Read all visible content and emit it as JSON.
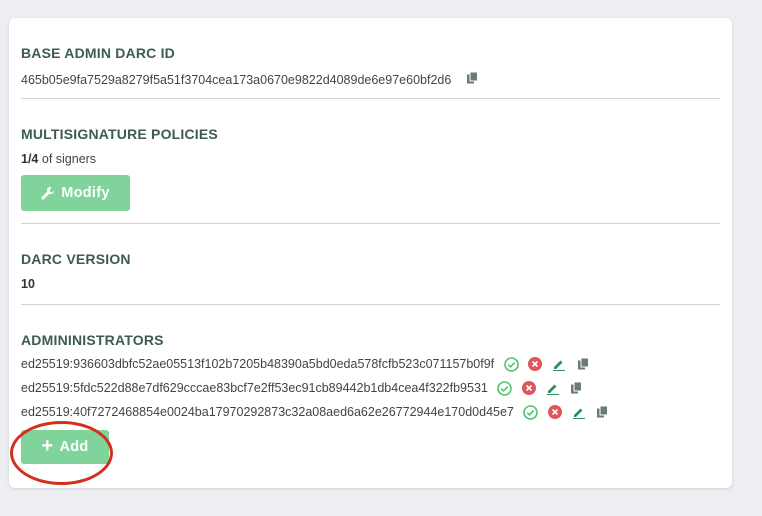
{
  "base_admin": {
    "heading": "BASE ADMIN DARC ID",
    "value": "465b05e9fa7529a8279f5a51f3704cea173a0670e9822d4089de6e97e60bf2d6"
  },
  "multisig": {
    "heading": "MULTISIGNATURE POLICIES",
    "ratio": "1/4",
    "suffix": " of signers",
    "modify_label": "Modify"
  },
  "darc_version": {
    "heading": "DARC VERSION",
    "value": "10"
  },
  "administrators": {
    "heading": "ADMININISTRATORS",
    "items": [
      "ed25519:936603dbfc52ae05513f102b7205b48390a5bd0eda578fcfb523c071157b0f9f",
      "ed25519:5fdc522d88e7df629cccae83bcf7e2ff53ec91cb89442b1db4cea4f322fb9531",
      "ed25519:40f7272468854e0024ba17970292873c32a08aed6a62e26772944e170d0d45e7"
    ],
    "add_label": "Add"
  },
  "colors": {
    "accent_green": "#7fd39b",
    "heading_text": "#3d5a55",
    "approve_green": "#4cc46f",
    "reject_red": "#e0555b",
    "annotation_red": "#d2301d"
  },
  "icons": [
    "copy-icon",
    "wrench-icon",
    "check-circle-icon",
    "x-circle-icon",
    "pencil-icon",
    "plus-icon"
  ]
}
